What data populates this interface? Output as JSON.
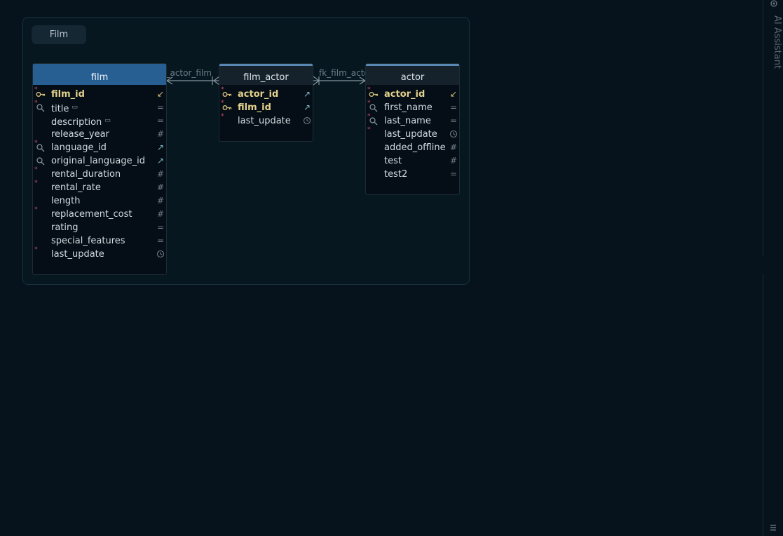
{
  "group": {
    "label": "Film"
  },
  "tables": {
    "film": {
      "name": "film",
      "columns": [
        {
          "name": "film_id",
          "pk": true,
          "required": true,
          "lead": "key",
          "tail": "↙"
        },
        {
          "name": "title",
          "required": true,
          "lead": "search",
          "tail": "=",
          "comment": true
        },
        {
          "name": "description",
          "tail": "=",
          "comment": true
        },
        {
          "name": "release_year",
          "tail": "#"
        },
        {
          "name": "language_id",
          "required": true,
          "lead": "search",
          "tail": "↗"
        },
        {
          "name": "original_language_id",
          "lead": "search",
          "tail": "↗"
        },
        {
          "name": "rental_duration",
          "required": true,
          "tail": "#"
        },
        {
          "name": "rental_rate",
          "required": true,
          "tail": "#"
        },
        {
          "name": "length",
          "tail": "#"
        },
        {
          "name": "replacement_cost",
          "required": true,
          "tail": "#"
        },
        {
          "name": "rating",
          "tail": "="
        },
        {
          "name": "special_features",
          "tail": "="
        },
        {
          "name": "last_update",
          "required": true,
          "tail": "clock"
        }
      ]
    },
    "film_actor": {
      "name": "film_actor",
      "columns": [
        {
          "name": "actor_id",
          "pk": true,
          "required": true,
          "lead": "key",
          "tail": "↗"
        },
        {
          "name": "film_id",
          "pk": true,
          "required": true,
          "lead": "key",
          "tail": "↗"
        },
        {
          "name": "last_update",
          "required": true,
          "tail": "clock"
        }
      ]
    },
    "actor": {
      "name": "actor",
      "columns": [
        {
          "name": "actor_id",
          "pk": true,
          "required": true,
          "lead": "key",
          "tail": "↙"
        },
        {
          "name": "first_name",
          "required": true,
          "lead": "search",
          "tail": "="
        },
        {
          "name": "last_name",
          "required": true,
          "lead": "search",
          "tail": "="
        },
        {
          "name": "last_update",
          "required": true,
          "tail": "clock"
        },
        {
          "name": "added_offline",
          "tail": "#"
        },
        {
          "name": "test",
          "tail": "#"
        },
        {
          "name": "test2",
          "tail": "="
        }
      ]
    }
  },
  "relations": [
    {
      "label": "fk_film_actor_film"
    },
    {
      "label": "fk_film_actor_actor"
    }
  ],
  "side_panel": {
    "title": "AI Assistant"
  },
  "colors": {
    "background": "#06121c",
    "selected_header": "#275f93",
    "header_accent": "#5a88b4",
    "primary_key": "#e3d08c",
    "required_marker": "#d0506d"
  }
}
